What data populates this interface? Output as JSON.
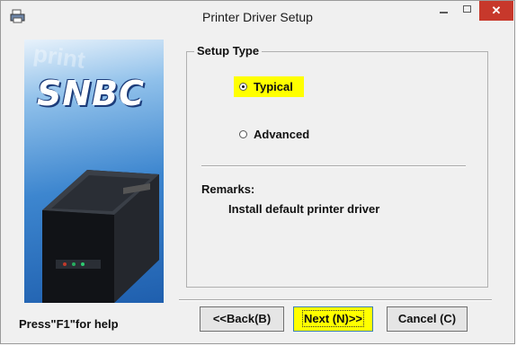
{
  "window": {
    "title": "Printer Driver Setup",
    "close_glyph": "✕"
  },
  "banner": {
    "logo": "SNBC",
    "watermark": "print"
  },
  "setup_type": {
    "legend": "Setup Type",
    "options": [
      {
        "label": "Typical",
        "selected": true
      },
      {
        "label": "Advanced",
        "selected": false
      }
    ],
    "remarks_label": "Remarks:",
    "remarks_text": "Install default printer driver"
  },
  "footer": {
    "help": "Press\"F1\"for help",
    "back_label": "<<Back(B)",
    "next_label": "Next (N)>>",
    "cancel_label": "Cancel (C)"
  },
  "colors": {
    "highlight": "#ffff00",
    "close_button": "#c7382b",
    "banner_blue": "#3d86cf"
  }
}
